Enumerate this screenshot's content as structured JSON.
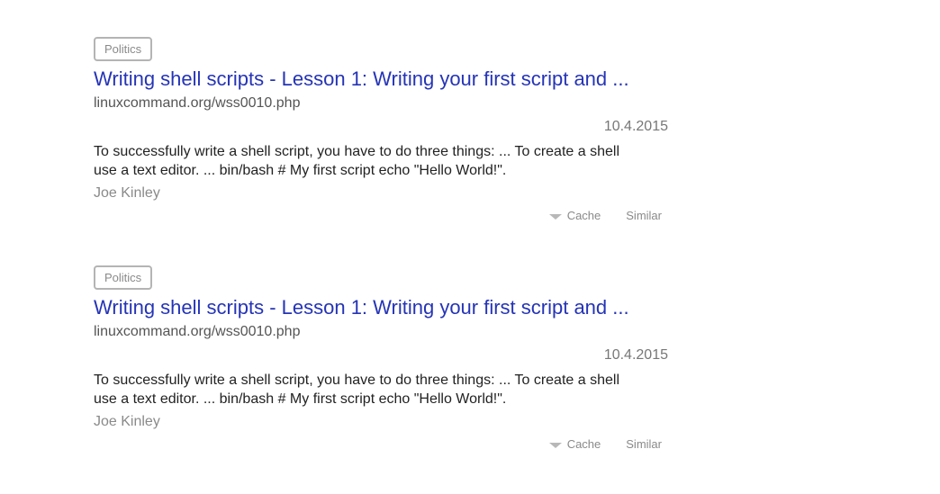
{
  "results": [
    {
      "category": "Politics",
      "title": "Writing shell scripts - Lesson 1: Writing your first script and ...",
      "url": "linuxcommand.org/wss0010.php",
      "date": "10.4.2015",
      "snippet_line1": "To successfully write a shell script, you have to do three things: ... To create a shell",
      "snippet_line2": "use a text editor. ... bin/bash # My first script echo \"Hello World!\".",
      "author": "Joe Kinley",
      "cache_label": "Cache",
      "similar_label": "Similar",
      "cache_icon": "caret-down-icon"
    },
    {
      "category": "Politics",
      "title": "Writing shell scripts - Lesson 1: Writing your first script and ...",
      "url": "linuxcommand.org/wss0010.php",
      "date": "10.4.2015",
      "snippet_line1": "To successfully write a shell script, you have to do three things: ... To create a shell",
      "snippet_line2": "use a text editor. ... bin/bash # My first script echo \"Hello World!\".",
      "author": "Joe Kinley",
      "cache_label": "Cache",
      "similar_label": "Similar",
      "cache_icon": "caret-down-icon"
    }
  ],
  "colors": {
    "title_link": "#2534b6",
    "badge_border": "#b4b4b4",
    "muted_text": "#8a8a8a",
    "body_text": "#222222"
  }
}
